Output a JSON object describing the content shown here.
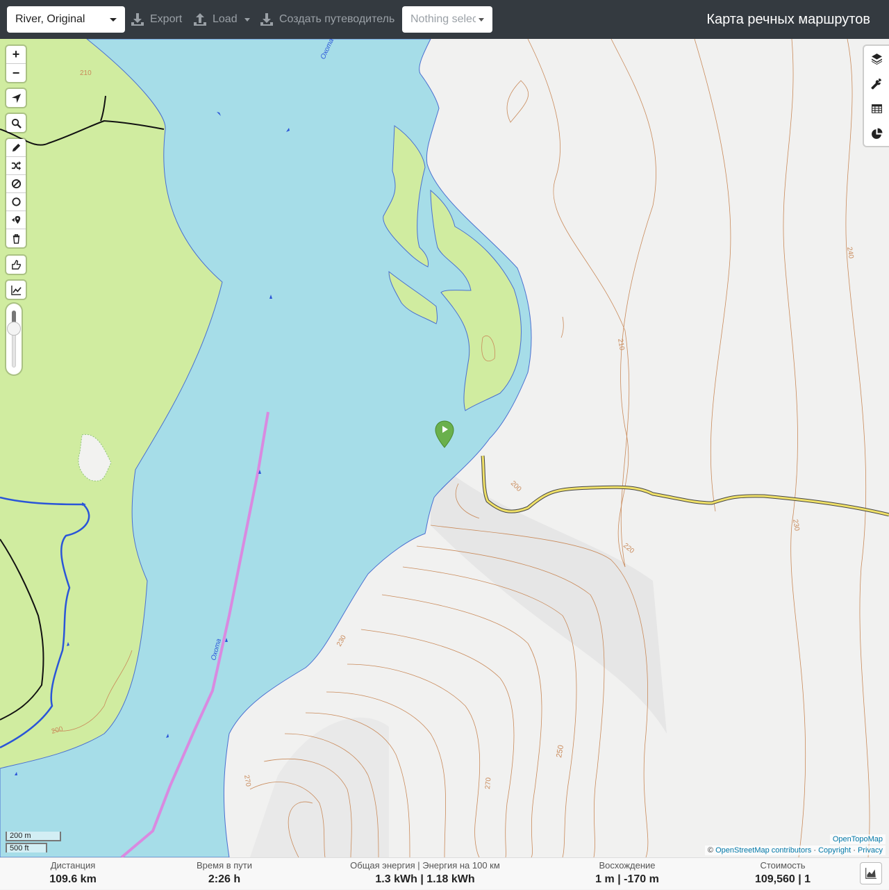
{
  "navbar": {
    "profile": "River, Original",
    "export_label": "Export",
    "load_label": "Load",
    "guide_label": "Создать путеводитель",
    "select_placeholder": "Nothing selected",
    "app_title": "Карта речных маршрутов"
  },
  "map": {
    "river_name": "Охота",
    "contours": [
      "210",
      "200",
      "220",
      "230",
      "240",
      "250",
      "270",
      "200",
      "230",
      "270"
    ],
    "scale_metric": "200 m",
    "scale_imperial": "500 ft",
    "attribution": {
      "provider": "OpenTopoMap",
      "copy_symbol": "©",
      "osm": "OpenStreetMap contributors",
      "sep1": "·",
      "copyright": "Copyright",
      "sep2": "·",
      "privacy": "Privacy"
    },
    "colors": {
      "water": "#a6dde8",
      "forest": "#d0eca0",
      "route": "#d98ae0",
      "road": "#f0e168",
      "contour": "#c98a5a"
    }
  },
  "toolbar": {
    "zoom_in": "+",
    "zoom_out": "−"
  },
  "stats": {
    "distance_label": "Дистанция",
    "distance_value": "109.6 km",
    "time_label": "Время в пути",
    "time_value": "2:26 h",
    "energy_label": "Общая энергия | Энергия на 100 км",
    "energy_value": "1.3 kWh | 1.18 kWh",
    "ascent_label": "Восхождение",
    "ascent_value": "1 m | -170 m",
    "cost_label": "Стоимость",
    "cost_value": "109,560 | 1"
  }
}
